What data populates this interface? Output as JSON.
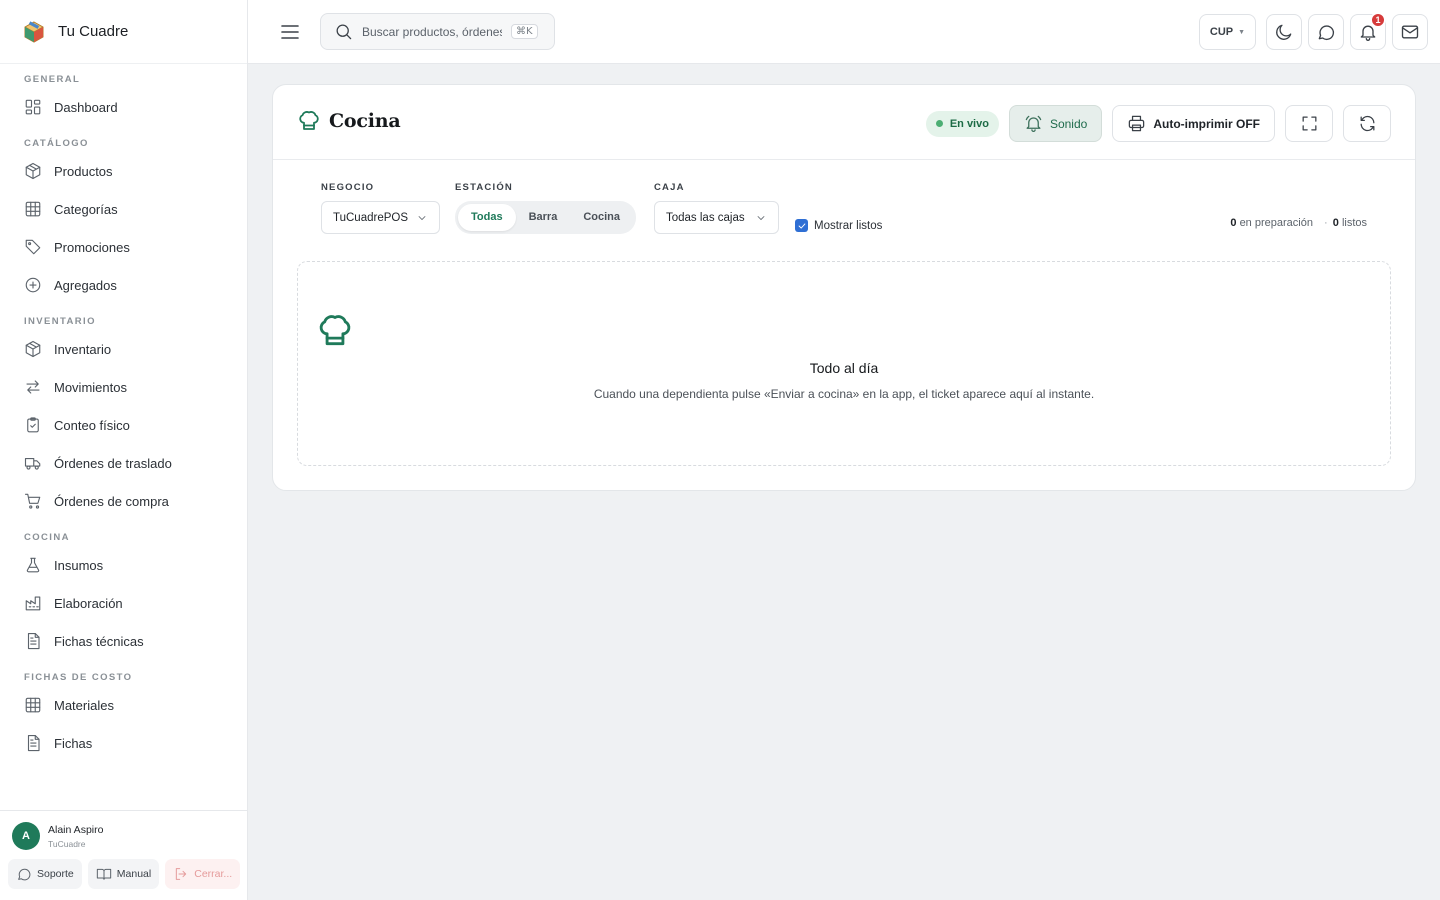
{
  "brand": {
    "name": "Tu Cuadre"
  },
  "sidebar": {
    "sections": [
      {
        "label": "GENERAL",
        "items": [
          {
            "label": "Dashboard",
            "icon": "dashboard-icon"
          }
        ]
      },
      {
        "label": "CATÁLOGO",
        "items": [
          {
            "label": "Productos",
            "icon": "box-icon"
          },
          {
            "label": "Categorías",
            "icon": "grid-icon"
          },
          {
            "label": "Promociones",
            "icon": "tag-icon"
          },
          {
            "label": "Agregados",
            "icon": "plus-circle-icon"
          }
        ]
      },
      {
        "label": "INVENTARIO",
        "items": [
          {
            "label": "Inventario",
            "icon": "box-icon"
          },
          {
            "label": "Movimientos",
            "icon": "arrows-icon"
          },
          {
            "label": "Conteo físico",
            "icon": "clipboard-check-icon"
          },
          {
            "label": "Órdenes de traslado",
            "icon": "truck-icon"
          },
          {
            "label": "Órdenes de compra",
            "icon": "cart-icon"
          }
        ]
      },
      {
        "label": "COCINA",
        "items": [
          {
            "label": "Insumos",
            "icon": "flask-icon"
          },
          {
            "label": "Elaboración",
            "icon": "factory-icon"
          },
          {
            "label": "Fichas técnicas",
            "icon": "document-icon"
          }
        ]
      },
      {
        "label": "FICHAS DE COSTO",
        "items": [
          {
            "label": "Materiales",
            "icon": "grid-icon"
          },
          {
            "label": "Fichas",
            "icon": "document-icon"
          }
        ]
      }
    ]
  },
  "user": {
    "initial": "A",
    "name": "Alain Aspiro",
    "org": "TuCuadre",
    "support_label": "Soporte",
    "manual_label": "Manual",
    "logout_label": "Cerrar..."
  },
  "topbar": {
    "search_placeholder": "Buscar productos, órdenes",
    "shortcut": "⌘K",
    "currency": "CUP",
    "notification_count": "1"
  },
  "page": {
    "title": "Cocina",
    "live_label": "En vivo",
    "sound_label": "Sonido",
    "autoprint_label": "Auto-imprimir OFF"
  },
  "filters": {
    "business_label": "NEGOCIO",
    "business_value": "TuCuadrePOS",
    "station_label": "ESTACIÓN",
    "stations": [
      "Todas",
      "Barra",
      "Cocina"
    ],
    "station_selected": "Todas",
    "register_label": "CAJA",
    "register_value": "Todas las cajas",
    "show_ready_label": "Mostrar listos",
    "show_ready_checked": true,
    "preparing_count": "0",
    "preparing_label": "en preparación",
    "ready_count": "0",
    "ready_label": "listos"
  },
  "empty_state": {
    "title": "Todo al día",
    "message": "Cuando una dependienta pulse «Enviar a cocina» en la app, el ticket aparece aquí al instante."
  },
  "colors": {
    "accent": "#1f7a5a",
    "live_bg": "#e4f3ea",
    "badge": "#d63b3b",
    "checkbox": "#2f6fd4"
  }
}
